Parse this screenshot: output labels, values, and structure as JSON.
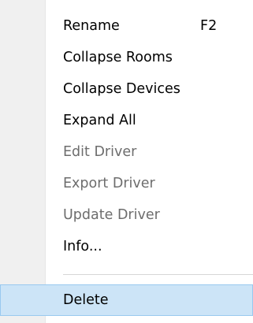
{
  "menu": {
    "items": [
      {
        "label": "Rename",
        "shortcut": "F2",
        "enabled": true
      },
      {
        "label": "Collapse Rooms",
        "enabled": true
      },
      {
        "label": "Collapse Devices",
        "enabled": true
      },
      {
        "label": "Expand All",
        "enabled": true
      },
      {
        "label": "Edit Driver",
        "enabled": false
      },
      {
        "label": "Export Driver",
        "enabled": false
      },
      {
        "label": "Update Driver",
        "enabled": false
      },
      {
        "label": "Info...",
        "enabled": true
      },
      {
        "label": "Delete",
        "enabled": true,
        "highlighted": true
      }
    ]
  },
  "colors": {
    "gutter": "#f0f0f0",
    "text": "#000000",
    "disabled_text": "#6d6d6d",
    "highlight_fill": "#cce4f7",
    "highlight_border": "#99c9ef"
  }
}
